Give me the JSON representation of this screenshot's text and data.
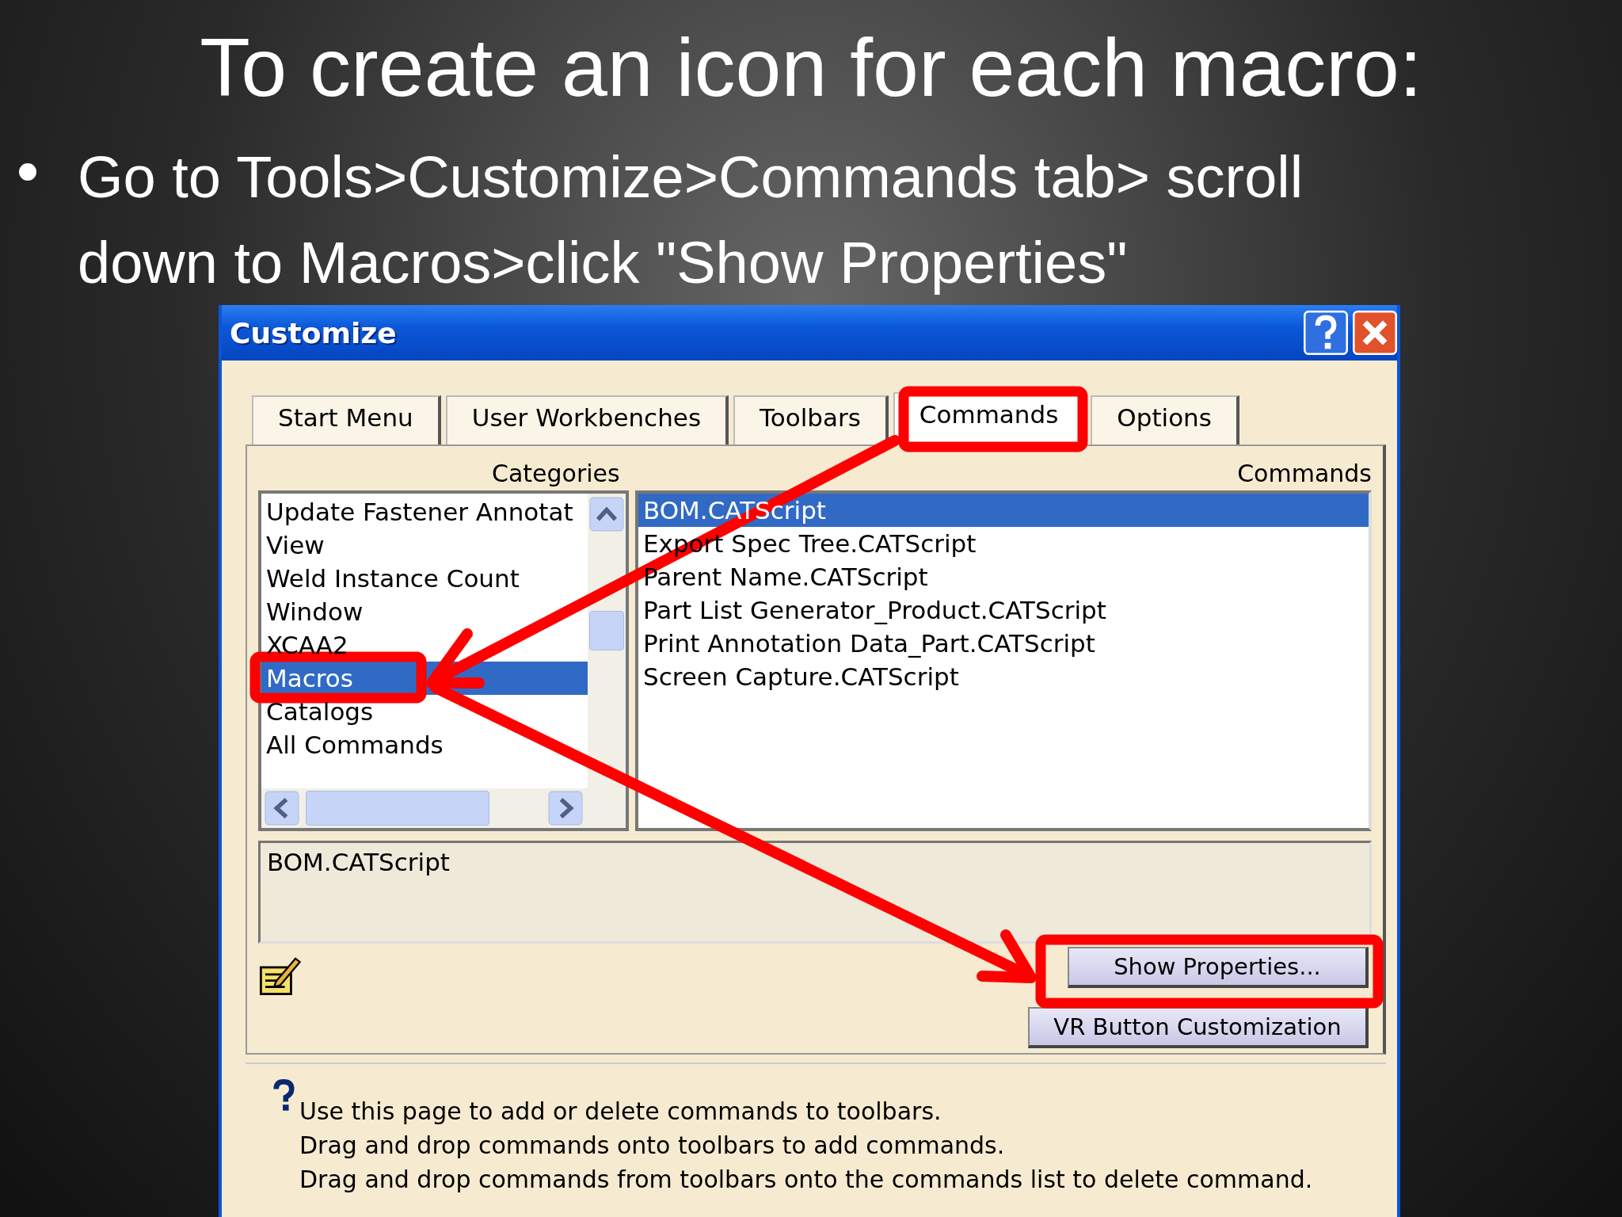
{
  "slide": {
    "title": "To create an icon for each macro:",
    "bullet": "Go to Tools>Customize>Commands tab> scroll down to Macros>click \"Show Properties\""
  },
  "window": {
    "title": "Customize"
  },
  "tabs": [
    {
      "label": "Start Menu",
      "selected": false
    },
    {
      "label": "User Workbenches",
      "selected": false
    },
    {
      "label": "Toolbars",
      "selected": false
    },
    {
      "label": "Commands",
      "selected": true
    },
    {
      "label": "Options",
      "selected": false
    }
  ],
  "categories": {
    "header": "Categories",
    "items": [
      {
        "label": "Update Fastener Annotat",
        "selected": false
      },
      {
        "label": "View",
        "selected": false
      },
      {
        "label": "Weld Instance Count",
        "selected": false
      },
      {
        "label": "Window",
        "selected": false
      },
      {
        "label": "XCAA2",
        "selected": false
      },
      {
        "label": "Macros",
        "selected": true
      },
      {
        "label": "Catalogs",
        "selected": false
      },
      {
        "label": "All Commands",
        "selected": false
      }
    ]
  },
  "commands": {
    "header": "Commands",
    "items": [
      {
        "label": "BOM.CATScript",
        "selected": true
      },
      {
        "label": "Export Spec Tree.CATScript",
        "selected": false
      },
      {
        "label": "Parent Name.CATScript",
        "selected": false
      },
      {
        "label": "Part List Generator_Product.CATScript",
        "selected": false
      },
      {
        "label": "Print Annotation Data_Part.CATScript",
        "selected": false
      },
      {
        "label": "Screen Capture.CATScript",
        "selected": false
      }
    ]
  },
  "description": "BOM.CATScript",
  "buttons": [
    "Show Properties...",
    "VR Button Customization"
  ],
  "info": [
    "Use this page to add or delete commands to toolbars.",
    "Drag and drop commands onto toolbars to add commands.",
    "Drag and drop commands from toolbars onto the commands list to delete command."
  ]
}
